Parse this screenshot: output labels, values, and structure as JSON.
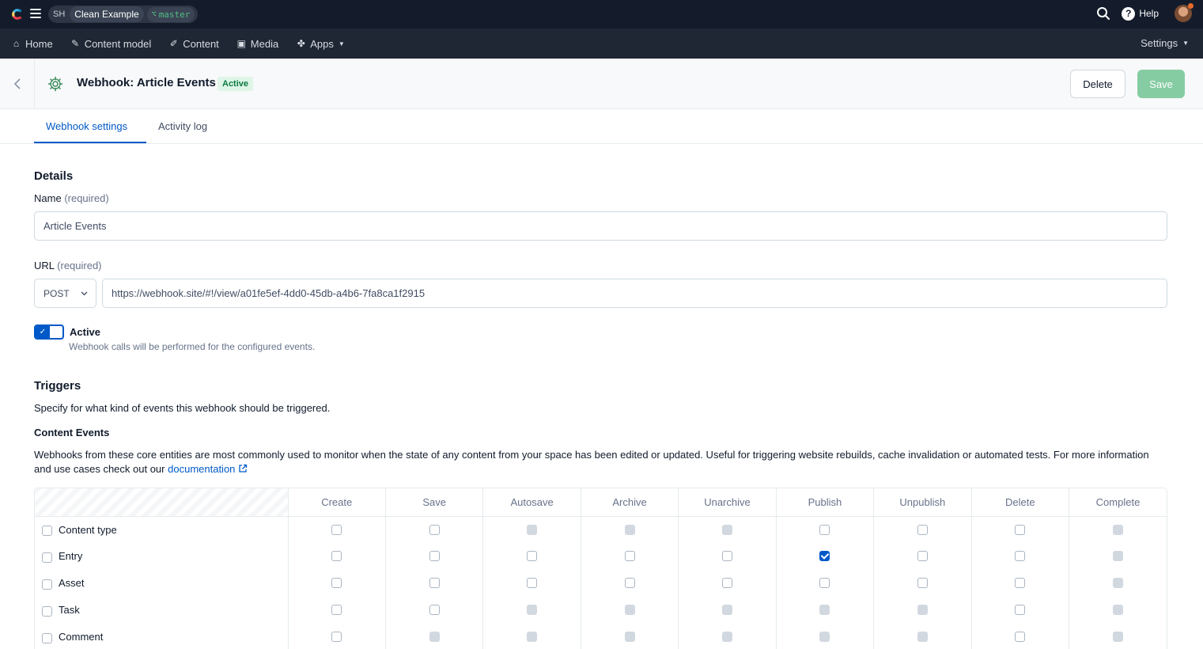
{
  "topbar": {
    "space_initials": "SH",
    "space_name": "Clean Example",
    "environment": "master",
    "help_label": "Help"
  },
  "nav": {
    "items": [
      {
        "label": "Home",
        "icon": "home-icon"
      },
      {
        "label": "Content model",
        "icon": "wrench-icon"
      },
      {
        "label": "Content",
        "icon": "pen-icon"
      },
      {
        "label": "Media",
        "icon": "image-icon"
      },
      {
        "label": "Apps",
        "icon": "puzzle-icon"
      }
    ],
    "settings_label": "Settings"
  },
  "header": {
    "title": "Webhook: Article Events",
    "status": "Active",
    "delete_label": "Delete",
    "save_label": "Save"
  },
  "tabs": [
    "Webhook settings",
    "Activity log"
  ],
  "details": {
    "heading": "Details",
    "name_label": "Name",
    "name_required": "(required)",
    "name_value": "Article Events",
    "url_label": "URL",
    "url_required": "(required)",
    "method": "POST",
    "url_value": "https://webhook.site/#!/view/a01fe5ef-4dd0-45db-a4b6-7fa8ca1f2915",
    "active_label": "Active",
    "active_help": "Webhook calls will be performed for the configured events.",
    "active_on": true
  },
  "triggers": {
    "heading": "Triggers",
    "description": "Specify for what kind of events this webhook should be triggered.",
    "content_events_heading": "Content Events",
    "content_events_text": "Webhooks from these core entities are most commonly used to monitor when the state of any content from your space has been edited or updated. Useful for triggering website rebuilds, cache invalidation or automated tests. For more information and use cases check out our",
    "doc_link": "documentation",
    "columns": [
      "Create",
      "Save",
      "Autosave",
      "Archive",
      "Unarchive",
      "Publish",
      "Unpublish",
      "Delete",
      "Complete"
    ],
    "rows": [
      {
        "label": "Content type",
        "cells": [
          "off",
          "off",
          "dis",
          "dis",
          "dis",
          "off",
          "off",
          "off",
          "dis"
        ]
      },
      {
        "label": "Entry",
        "cells": [
          "off",
          "off",
          "off",
          "off",
          "off",
          "on",
          "off",
          "off",
          "dis"
        ]
      },
      {
        "label": "Asset",
        "cells": [
          "off",
          "off",
          "off",
          "off",
          "off",
          "off",
          "off",
          "off",
          "dis"
        ]
      },
      {
        "label": "Task",
        "cells": [
          "off",
          "off",
          "dis",
          "dis",
          "dis",
          "dis",
          "dis",
          "off",
          "dis"
        ]
      },
      {
        "label": "Comment",
        "cells": [
          "off",
          "dis",
          "dis",
          "dis",
          "dis",
          "dis",
          "dis",
          "off",
          "dis"
        ]
      }
    ]
  }
}
